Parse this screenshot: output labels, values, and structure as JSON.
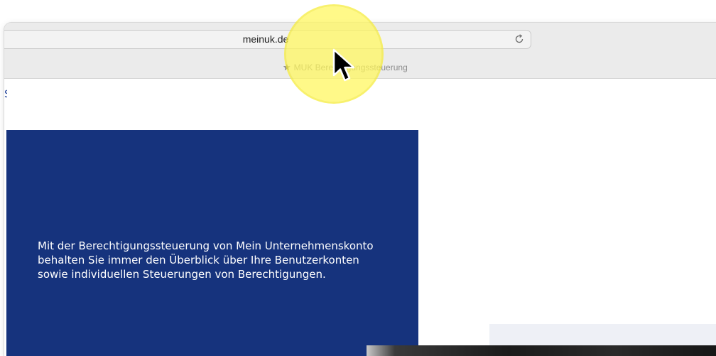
{
  "browser": {
    "url": "meinuk.de",
    "bookmark_label": "MUK Berechtigungssteuerung"
  },
  "page": {
    "hero_text": "Mit der Berechtigungssteuerung von Mein Unternehmenskonto behalten Sie immer den Überblick über Ihre Benutzerkonten sowie individuellen Steuerungen von Berechtigungen."
  },
  "colors": {
    "hero_background": "#16337d",
    "highlight": "#fff75a"
  },
  "icons": {
    "reload": "reload-icon",
    "bookmark": "star-icon",
    "cursor": "mouse-pointer-icon"
  }
}
